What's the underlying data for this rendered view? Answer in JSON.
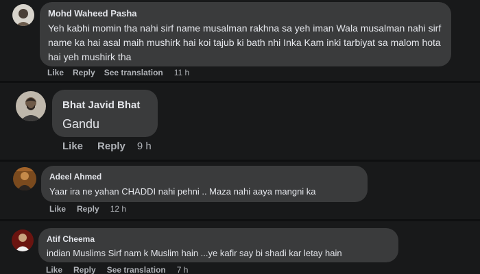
{
  "comments": [
    {
      "author": "Mohd Waheed Pasha",
      "text": "Yeh kabhi momin tha nahi sirf name musalman rakhna sa yeh iman Wala musalman nahi sirf name ka hai asal maih mushirk hai koi tajub ki bath nhi Inka Kam inki tarbiyat sa malom hota hai yeh mushirk tha",
      "actions": [
        "Like",
        "Reply",
        "See translation"
      ],
      "time": "11 h"
    },
    {
      "author": "Bhat Javid Bhat",
      "text": "Gandu",
      "actions": [
        "Like",
        "Reply"
      ],
      "time": "9 h"
    },
    {
      "author": "Adeel Ahmed",
      "text": "Yaar ira ne yahan CHADDI nahi pehni .. Maza nahi aaya mangni ka",
      "actions": [
        "Like",
        "Reply"
      ],
      "time": "12 h"
    },
    {
      "author": "Atif Cheema",
      "text": "indian Muslims Sirf nam k Muslim hain ...ye kafir say bi shadi kar letay hain",
      "actions": [
        "Like",
        "Reply",
        "See translation"
      ],
      "time": "7 h"
    }
  ],
  "colors": {
    "background": "#18191a",
    "bubble": "#3a3b3c",
    "text": "#e4e6eb",
    "secondary": "#b0b3b8"
  }
}
